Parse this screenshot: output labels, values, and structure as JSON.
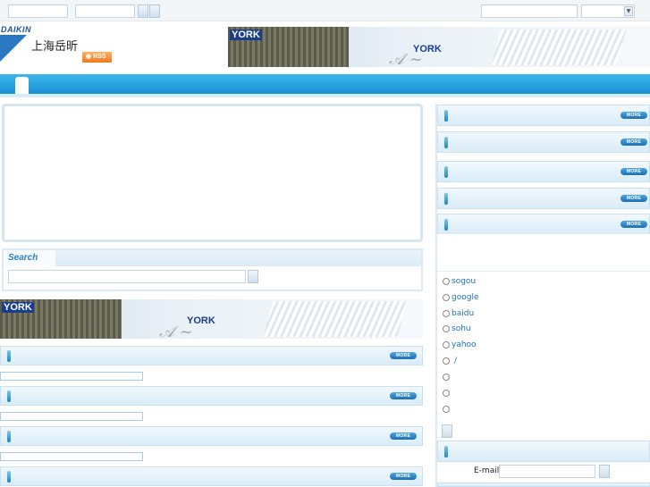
{
  "header": {
    "daikin_brand": "DAIKIN",
    "company_name": "上海岳昕",
    "rss_label": "RSS",
    "banner_brand": "YORK"
  },
  "search": {
    "title": "Search"
  },
  "more_label": "MORE",
  "right": {
    "search_engines": [
      "sogou",
      "google",
      "baidu",
      "sohu",
      "yahoo",
      "/",
      "",
      "",
      ""
    ],
    "email_label": "E-mail"
  },
  "colors": {
    "nav_blue": "#1590d4",
    "panel_border": "#d5e6f3",
    "link_blue": "#1f6fb8"
  }
}
